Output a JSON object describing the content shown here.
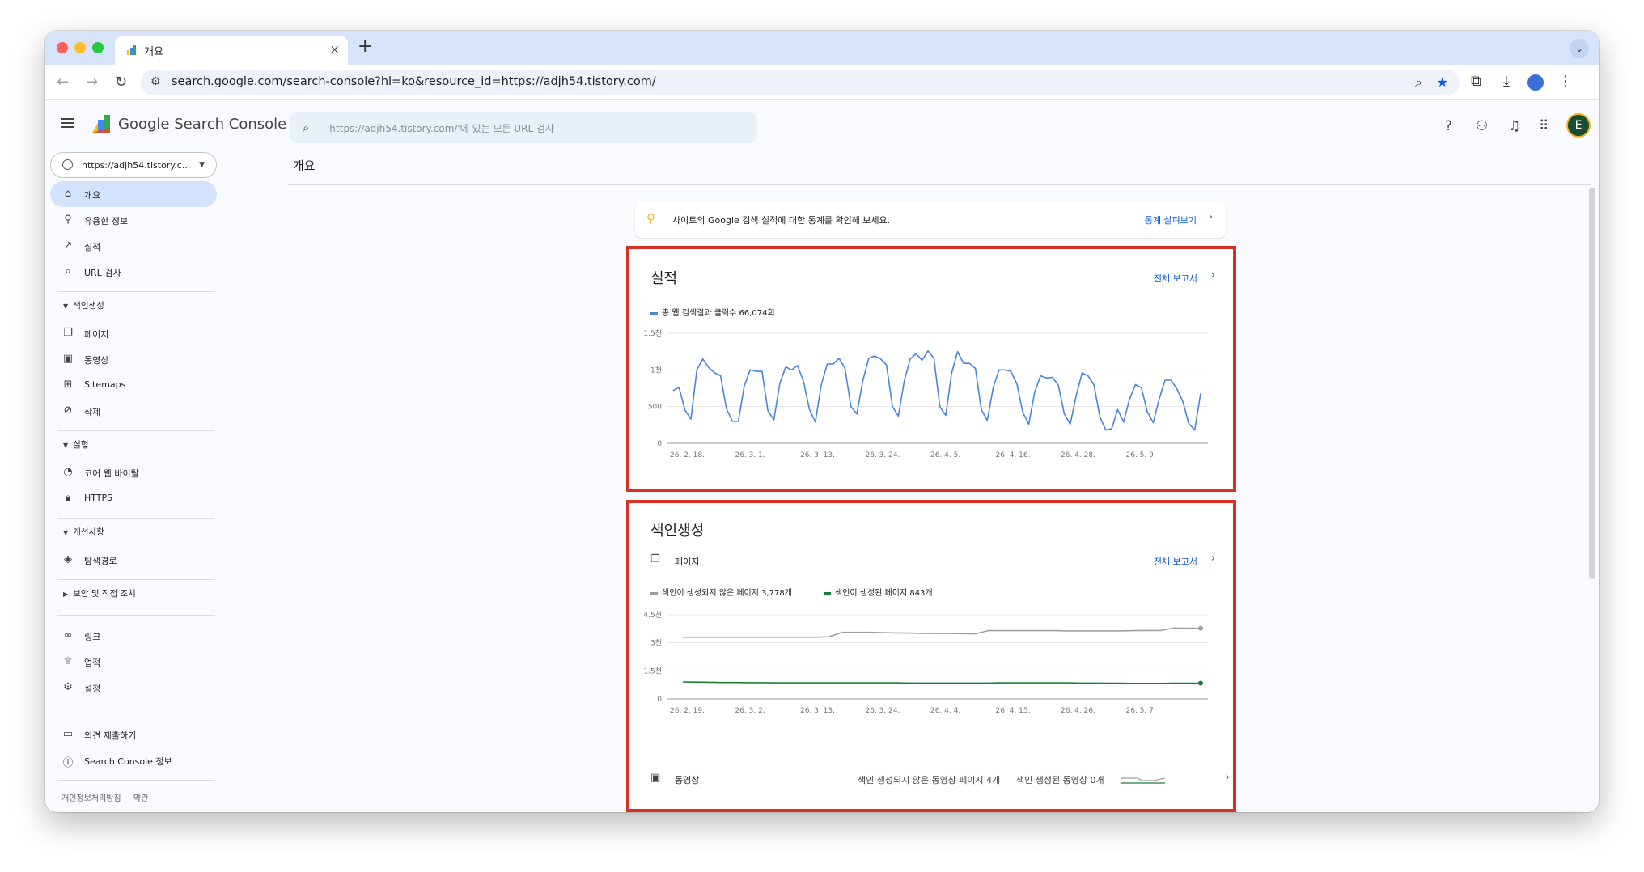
{
  "browser": {
    "tab_title": "개요",
    "tab_close": "×",
    "new_tab": "+",
    "tab_menu": "⌄",
    "url": "search.google.com/search-console?hl=ko&resource_id=https://adjh54.tistory.com/"
  },
  "app": {
    "product_name": "Google Search Console",
    "search_placeholder": "'https://adjh54.tistory.com/'에 있는 모든 URL 검사",
    "avatar_letter": "E"
  },
  "sidebar": {
    "property": "https://adjh54.tistory.c...",
    "items_top": [
      {
        "label": "개요",
        "icon": "home-icon"
      },
      {
        "label": "유용한 정보",
        "icon": "lightbulb-icon"
      },
      {
        "label": "실적",
        "icon": "trending-icon"
      },
      {
        "label": "URL 검사",
        "icon": "search-icon"
      }
    ],
    "group_indexing": "색인생성",
    "items_indexing": [
      {
        "label": "페이지",
        "icon": "pages-icon"
      },
      {
        "label": "동영상",
        "icon": "video-icon"
      },
      {
        "label": "Sitemaps",
        "icon": "sitemap-icon"
      },
      {
        "label": "삭제",
        "icon": "removal-icon"
      }
    ],
    "group_experience": "실험",
    "items_experience": [
      {
        "label": "코어 웹 바이탈",
        "icon": "gauge-icon"
      },
      {
        "label": "HTTPS",
        "icon": "lock-icon"
      }
    ],
    "group_enhancements": "개선사항",
    "items_enhancements": [
      {
        "label": "탐색경로",
        "icon": "layers-icon"
      }
    ],
    "group_security": "보안 및 직접 조치",
    "items_bottom": [
      {
        "label": "링크",
        "icon": "link-icon"
      },
      {
        "label": "업적",
        "icon": "trophy-icon"
      },
      {
        "label": "설정",
        "icon": "settings-icon"
      }
    ],
    "items_footer": [
      {
        "label": "의견 제출하기",
        "icon": "feedback-icon"
      },
      {
        "label": "Search Console 정보",
        "icon": "info-icon"
      }
    ],
    "privacy": "개인정보처리방침",
    "terms": "약관"
  },
  "main": {
    "page_title": "개요",
    "banner_text": "사이트의 Google 검색 실적에 대한 통계를 확인해 보세요.",
    "banner_link": "통계 살펴보기"
  },
  "performance": {
    "title": "실적",
    "link": "전체 보고서",
    "legend": "총 웹 검색결과 클릭수 66,074회",
    "series_color": "#4a86d8"
  },
  "indexing": {
    "title": "색인생성",
    "pages_label": "페이지",
    "link": "전체 보고서",
    "legend_not_indexed": "색인이 생성되지 않은 페이지 3,778개",
    "legend_indexed": "색인이 생성된 페이지 843개",
    "not_indexed_color": "#9e9e9e",
    "indexed_color": "#188038",
    "video_label": "동영상",
    "video_not_indexed": "색인 생성되지 않은 동영상 페이지 4개",
    "video_indexed": "색인 생성된 동영상 0개"
  },
  "chart_data": [
    {
      "type": "line",
      "title": "실적",
      "series": [
        {
          "name": "총 웹 검색결과 클릭수 66,074회",
          "values": [
            720,
            760,
            450,
            330,
            1000,
            1150,
            1030,
            960,
            920,
            470,
            300,
            300,
            780,
            1000,
            980,
            980,
            440,
            320,
            820,
            1040,
            1000,
            1060,
            840,
            460,
            290,
            800,
            1080,
            1080,
            1160,
            1020,
            500,
            400,
            850,
            1160,
            1190,
            1150,
            1070,
            500,
            370,
            850,
            1150,
            1220,
            1130,
            1260,
            1160,
            500,
            380,
            960,
            1250,
            1090,
            1090,
            1020,
            460,
            310,
            760,
            1000,
            1000,
            980,
            810,
            420,
            260,
            700,
            920,
            890,
            900,
            790,
            400,
            260,
            650,
            960,
            920,
            800,
            360,
            180,
            200,
            460,
            290,
            600,
            800,
            760,
            430,
            280,
            600,
            860,
            860,
            740,
            570,
            270,
            180,
            680
          ]
        }
      ],
      "x_tick_labels": [
        "26. 2. 18.",
        "26. 3. 1.",
        "26. 3. 13.",
        "26. 3. 24.",
        "26. 4. 5.",
        "26. 4. 16.",
        "26. 4. 28.",
        "26. 5. 9."
      ],
      "y_tick_labels": [
        "0",
        "500",
        "1천",
        "1.5천"
      ],
      "ylim": [
        0,
        1500
      ]
    },
    {
      "type": "line",
      "title": "색인생성",
      "series": [
        {
          "name": "색인이 생성되지 않은 페이지 3,778개",
          "values": [
            3300,
            3300,
            3300,
            3300,
            3300,
            3300,
            3300,
            3300,
            3300,
            3300,
            3300,
            3320,
            3560,
            3560,
            3560,
            3550,
            3530,
            3520,
            3510,
            3500,
            3500,
            3490,
            3480,
            3650,
            3650,
            3650,
            3650,
            3650,
            3650,
            3640,
            3640,
            3640,
            3640,
            3640,
            3650,
            3660,
            3660,
            3790,
            3780,
            3778
          ]
        },
        {
          "name": "색인이 생성된 페이지 843개",
          "values": [
            910,
            900,
            890,
            880,
            880,
            870,
            870,
            860,
            860,
            860,
            860,
            860,
            860,
            860,
            860,
            860,
            860,
            850,
            850,
            850,
            850,
            850,
            850,
            850,
            860,
            860,
            860,
            860,
            860,
            860,
            850,
            850,
            840,
            840,
            830,
            830,
            830,
            840,
            840,
            843
          ]
        }
      ],
      "x_tick_labels": [
        "26. 2. 19.",
        "26. 3. 2.",
        "26. 3. 13.",
        "26. 3. 24.",
        "26. 4. 4.",
        "26. 4. 15.",
        "26. 4. 26.",
        "26. 5. 7."
      ],
      "y_tick_labels": [
        "0",
        "1.5천",
        "3천",
        "4.5천"
      ],
      "ylim": [
        0,
        4500
      ]
    }
  ]
}
